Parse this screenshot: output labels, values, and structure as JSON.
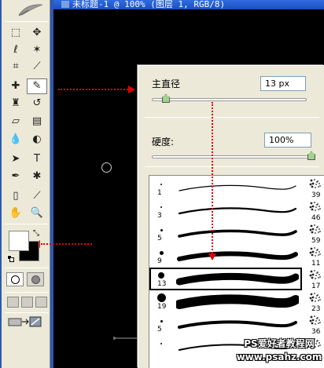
{
  "document": {
    "title": "未标题-1 @ 100% (图层 1, RGB/8)"
  },
  "toolbox": {
    "tools": [
      {
        "name": "marquee-tool",
        "glyph": "⬚"
      },
      {
        "name": "move-tool",
        "glyph": "✥"
      },
      {
        "name": "lasso-tool",
        "glyph": "ℓ"
      },
      {
        "name": "magic-wand-tool",
        "glyph": "✶"
      },
      {
        "name": "crop-tool",
        "glyph": "⌗"
      },
      {
        "name": "slice-tool",
        "glyph": "⟋"
      },
      {
        "name": "healing-brush-tool",
        "glyph": "✚"
      },
      {
        "name": "brush-tool",
        "glyph": "✎"
      },
      {
        "name": "clone-stamp-tool",
        "glyph": "♜"
      },
      {
        "name": "history-brush-tool",
        "glyph": "↺"
      },
      {
        "name": "eraser-tool",
        "glyph": "▱"
      },
      {
        "name": "gradient-tool",
        "glyph": "▤"
      },
      {
        "name": "blur-tool",
        "glyph": "💧"
      },
      {
        "name": "dodge-tool",
        "glyph": "◐"
      },
      {
        "name": "path-selection-tool",
        "glyph": "➤"
      },
      {
        "name": "type-tool",
        "glyph": "T"
      },
      {
        "name": "pen-tool",
        "glyph": "✒"
      },
      {
        "name": "custom-shape-tool",
        "glyph": "✱"
      },
      {
        "name": "notes-tool",
        "glyph": "▯"
      },
      {
        "name": "eyedropper-tool",
        "glyph": "⟋"
      },
      {
        "name": "hand-tool",
        "glyph": "✋"
      },
      {
        "name": "zoom-tool",
        "glyph": "🔍"
      }
    ],
    "foreground_color": "#ffffff",
    "background_color": "#000000"
  },
  "brush_panel": {
    "master_diameter_label": "主直径",
    "master_diameter_value": "13 px",
    "master_diameter_fraction": 0.04,
    "hardness_label": "硬度:",
    "hardness_value": "100%",
    "hardness_fraction": 1.0,
    "selected_index": 4,
    "brushes": [
      {
        "size": "1",
        "right_num": "39"
      },
      {
        "size": "3",
        "right_num": "46"
      },
      {
        "size": "5",
        "right_num": "59"
      },
      {
        "size": "9",
        "right_num": "11"
      },
      {
        "size": "13",
        "right_num": "17"
      },
      {
        "size": "19",
        "right_num": "23"
      },
      {
        "size": "5",
        "right_num": "36"
      },
      {
        "size": "",
        "right_num": ""
      }
    ]
  },
  "watermark": {
    "line1": "PS爱好者教程网",
    "line2": "www.psahz.com"
  },
  "colors": {
    "arrow": "#e00000",
    "titlebar": "#2f6ce0",
    "panel": "#ece9d8",
    "slider_thumb": "#9fd28c"
  }
}
